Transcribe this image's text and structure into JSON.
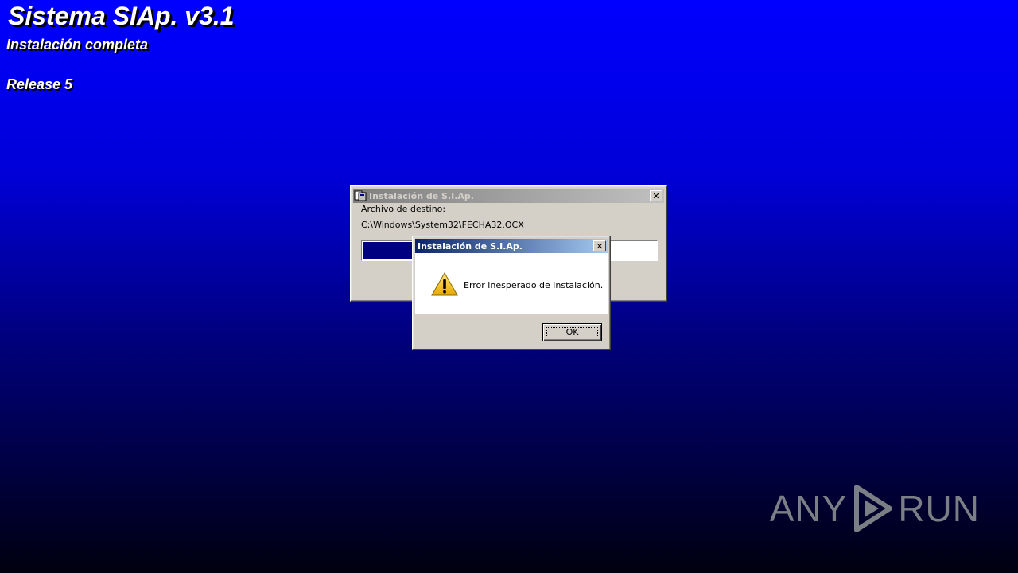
{
  "background": {
    "title": "Sistema SIAp. v3.1",
    "subtitle": "Instalación completa",
    "release": "Release 5"
  },
  "install_dialog": {
    "title": "Instalación de S.I.Ap.",
    "dest_label": "Archivo de destino:",
    "dest_path": "C:\\Windows\\System32\\FECHA32.OCX",
    "close_label": "✕",
    "progress_fraction": 0.17
  },
  "error_dialog": {
    "title": "Instalación de S.I.Ap.",
    "close_label": "✕",
    "message": "Error inesperado de instalación.",
    "ok_label": "OK",
    "icon": "warning-icon"
  },
  "watermark": {
    "left": "ANY",
    "right": "RUN"
  },
  "colors": {
    "desktop_top": "#0000ff",
    "desktop_bottom": "#000010",
    "progress_fill": "#000080",
    "active_title_start": "#0a246a",
    "active_title_end": "#a6caf0"
  }
}
